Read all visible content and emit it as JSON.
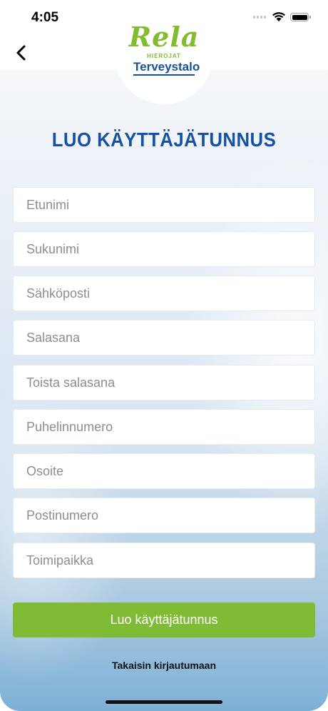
{
  "status_bar": {
    "time": "4:05"
  },
  "header": {
    "brand_name": "Rela",
    "brand_sub": "HIEROJAT",
    "brand_partner": "Terveystalo"
  },
  "title": "LUO KÄYTTÄJÄTUNNUS",
  "form": {
    "fields": [
      {
        "placeholder": "Etunimi"
      },
      {
        "placeholder": "Sukunimi"
      },
      {
        "placeholder": "Sähköposti"
      },
      {
        "placeholder": "Salasana"
      },
      {
        "placeholder": "Toista salasana"
      },
      {
        "placeholder": "Puhelinnumero"
      },
      {
        "placeholder": "Osoite"
      },
      {
        "placeholder": "Postinumero"
      },
      {
        "placeholder": "Toimipaikka"
      }
    ],
    "submit_label": "Luo käyttäjätunnus",
    "back_link_label": "Takaisin kirjautumaan"
  },
  "colors": {
    "accent_green": "#80bb35",
    "title_blue": "#1552a5"
  }
}
